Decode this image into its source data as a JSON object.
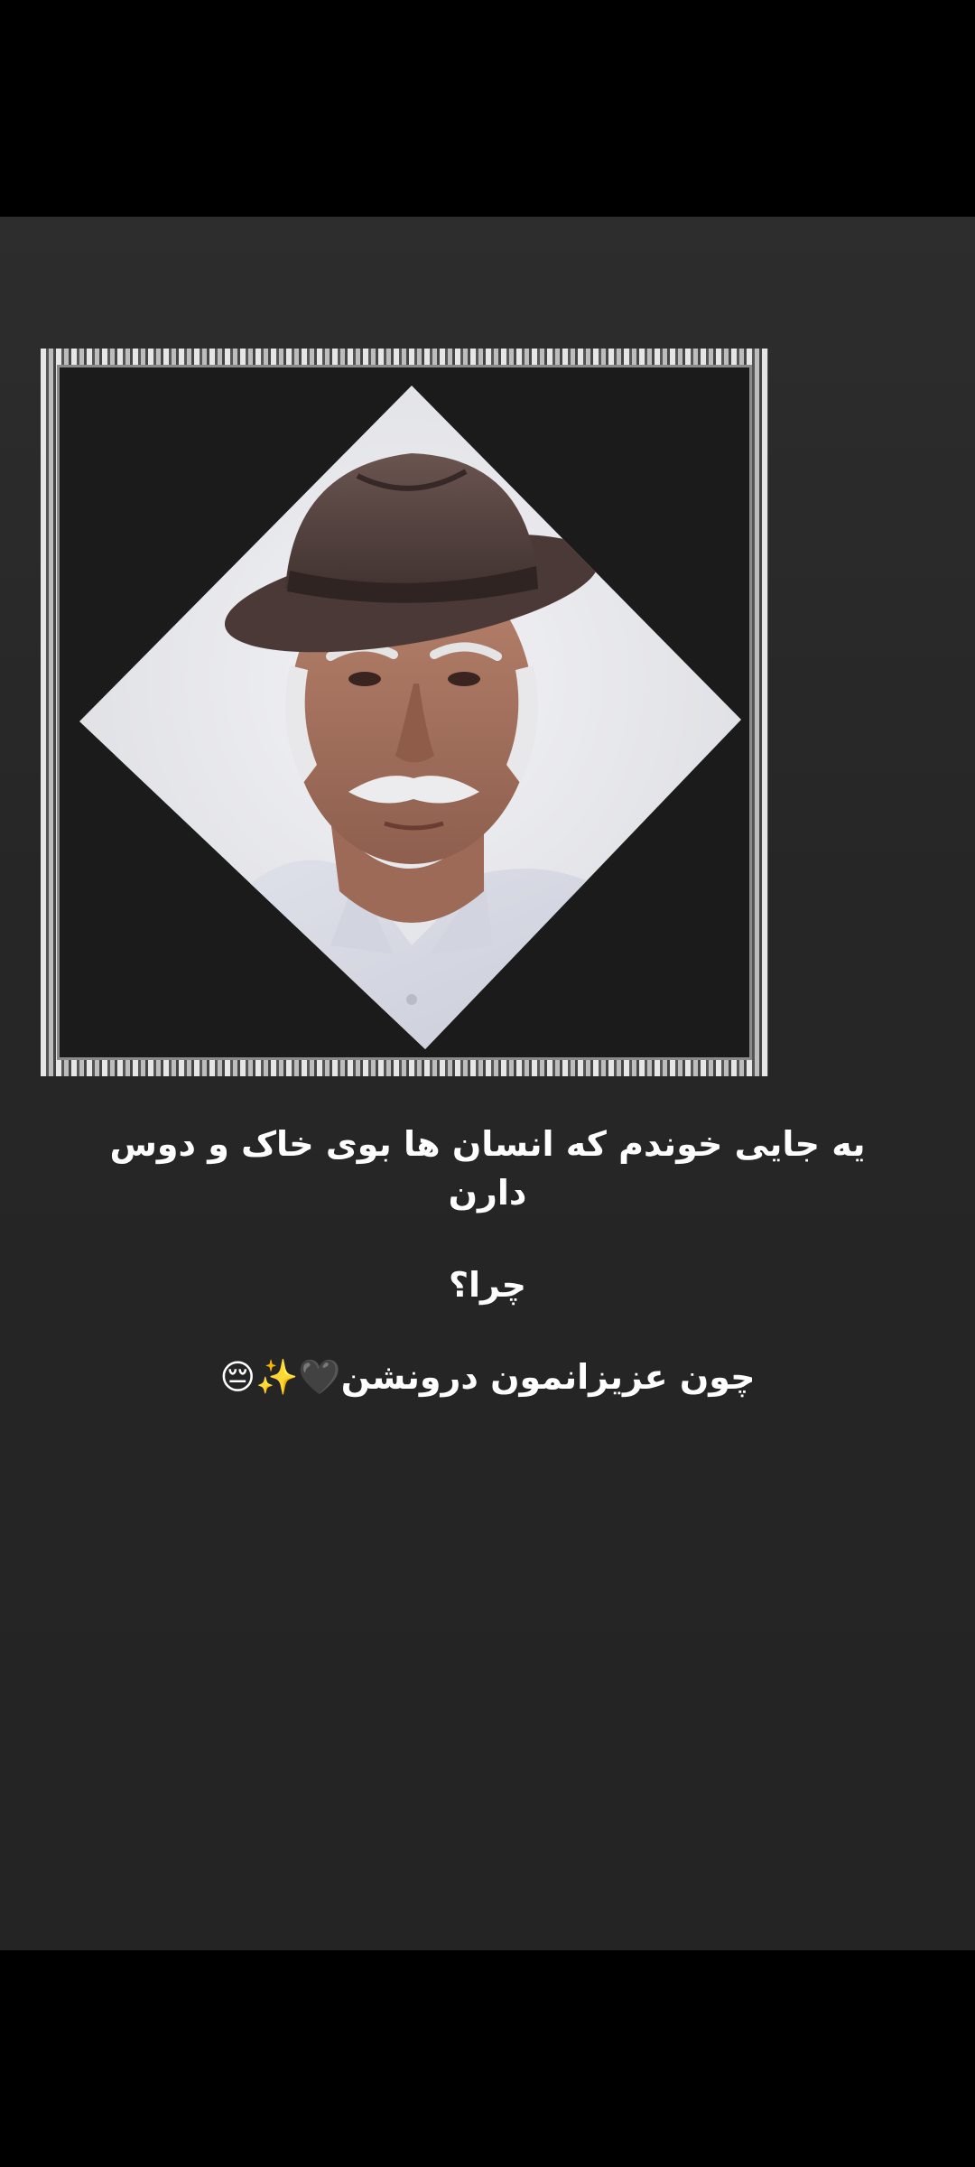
{
  "story": {
    "caption_line1": "یه جایی خوندم که انسان ها بوی خاک و دوس دارن",
    "caption_question": "چرا؟",
    "caption_answer": "چون عزیزانمون درونشن",
    "caption_emojis": "🖤✨😔"
  },
  "colors": {
    "story_background": "#262626",
    "frame_background": "#1b1b1b",
    "text": "#ffffff",
    "photo_background": "#e9eaee"
  },
  "icons": {
    "portrait": "elderly-man-portrait"
  }
}
